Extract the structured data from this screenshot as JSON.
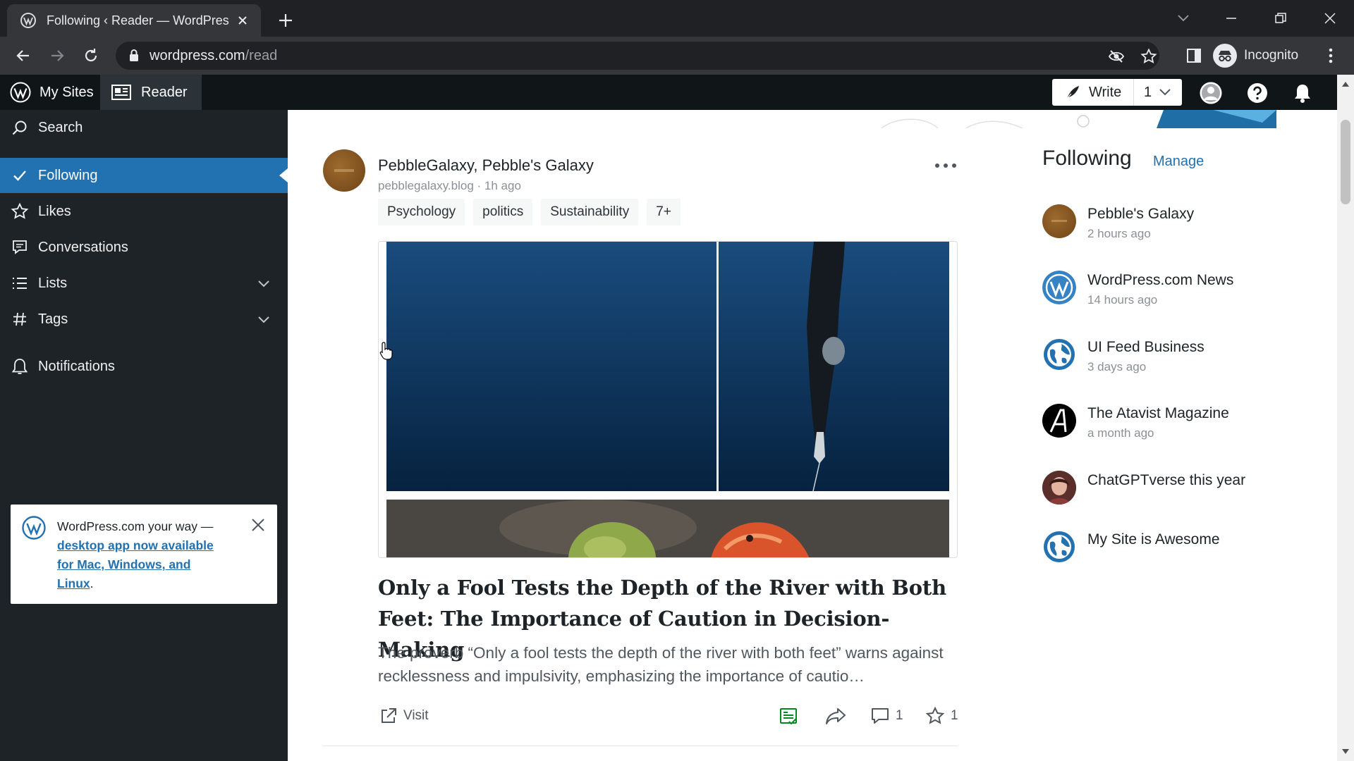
{
  "browser": {
    "tab_title": "Following ‹ Reader — WordPress.com",
    "url_host": "wordpress.com",
    "url_path": "/read",
    "profile_label": "Incognito"
  },
  "masterbar": {
    "my_sites": "My Sites",
    "reader": "Reader",
    "write": "Write",
    "draft_count": "1"
  },
  "sidebar": {
    "search": "Search",
    "items": [
      {
        "label": "Following",
        "icon": "checkmark-icon",
        "selected": true
      },
      {
        "label": "Likes",
        "icon": "star-icon"
      },
      {
        "label": "Conversations",
        "icon": "comment-icon"
      },
      {
        "label": "Lists",
        "icon": "list-icon",
        "expandable": true
      },
      {
        "label": "Tags",
        "icon": "hash-icon",
        "expandable": true
      },
      {
        "label": "Notifications",
        "icon": "bell-icon"
      }
    ],
    "promo": {
      "prefix": "WordPress.com your way — ",
      "link": "desktop app now available for Mac, Windows, and Linux",
      "suffix": "."
    }
  },
  "post": {
    "author": "PebbleGalaxy",
    "separator": ", ",
    "site_name": "Pebble's Galaxy",
    "site_url": "pebblegalaxy.blog",
    "meta_separator": " · ",
    "time": "1h ago",
    "tags": [
      "Psychology",
      "politics",
      "Sustainability",
      "7+"
    ],
    "title": "Only a Fool Tests the Depth of the River with Both Feet: The Importance of Caution in Decision-Making",
    "excerpt": "The proverb “Only a fool tests the depth of the river with both feet” warns against recklessness and impulsivity, emphasizing the importance of cautio…",
    "visit_label": "Visit",
    "comment_count": "1",
    "like_count": "1"
  },
  "following_panel": {
    "title": "Following",
    "manage": "Manage",
    "sites": [
      {
        "name": "Pebble's Galaxy",
        "time": "2 hours ago",
        "avatar": "pebble"
      },
      {
        "name": "WordPress.com News",
        "time": "14 hours ago",
        "avatar": "wordpress"
      },
      {
        "name": "UI Feed Business",
        "time": "3 days ago",
        "avatar": "globe"
      },
      {
        "name": "The Atavist Magazine",
        "time": "a month ago",
        "avatar": "atavist"
      },
      {
        "name": "ChatGPTverse this year",
        "time": "",
        "avatar": "person"
      },
      {
        "name": "My Site is Awesome",
        "time": "",
        "avatar": "globe"
      }
    ]
  },
  "colors": {
    "accent": "#2271b1",
    "sidebar_bg": "#1d2327",
    "masterbar_bg": "#101517"
  }
}
